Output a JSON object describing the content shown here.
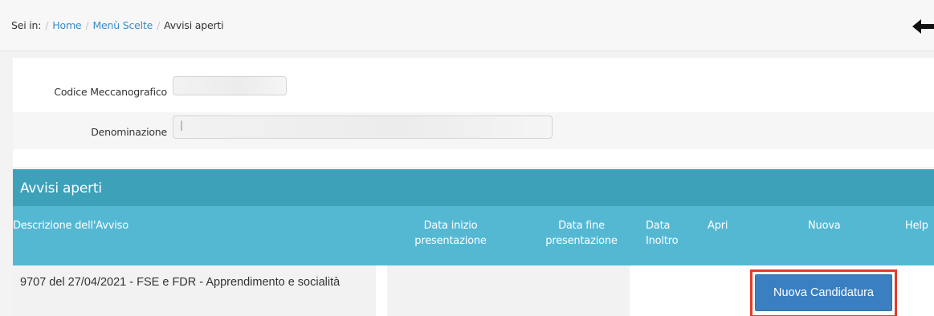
{
  "breadcrumb": {
    "prefix": "Sei in:",
    "items": [
      {
        "label": "Home",
        "link": true
      },
      {
        "label": "Menù Scelte",
        "link": true
      },
      {
        "label": "Avvisi aperti",
        "link": false
      }
    ],
    "separator": "/"
  },
  "form": {
    "codice_label": "Codice Meccanografico",
    "codice_value": "",
    "denominazione_label": "Denominazione",
    "denominazione_value": "|"
  },
  "section": {
    "title": "Avvisi aperti"
  },
  "table": {
    "headers": {
      "descrizione": "Descrizione dell'Avviso",
      "data_inizio": "Data inizio\npresentazione",
      "data_fine": "Data fine\npresentazione",
      "data_inoltro": "Data\nInoltro",
      "apri": "Apri",
      "nuova": "Nuova",
      "help": "Help"
    },
    "rows": [
      {
        "descrizione": "9707 del 27/04/2021 - FSE e FDR - Apprendimento e socialità",
        "data_inizio": "",
        "data_fine": "",
        "data_inoltro": "",
        "nuova_button": "Nuova Candidatura"
      }
    ]
  },
  "colors": {
    "section_title_bg": "#3ea1ba",
    "table_header_bg": "#54b8d3",
    "button_bg": "#3a7fc1",
    "highlight_border": "#e53a2a",
    "link": "#3a8cc6"
  },
  "icons": {
    "back": "arrow-left-icon"
  }
}
